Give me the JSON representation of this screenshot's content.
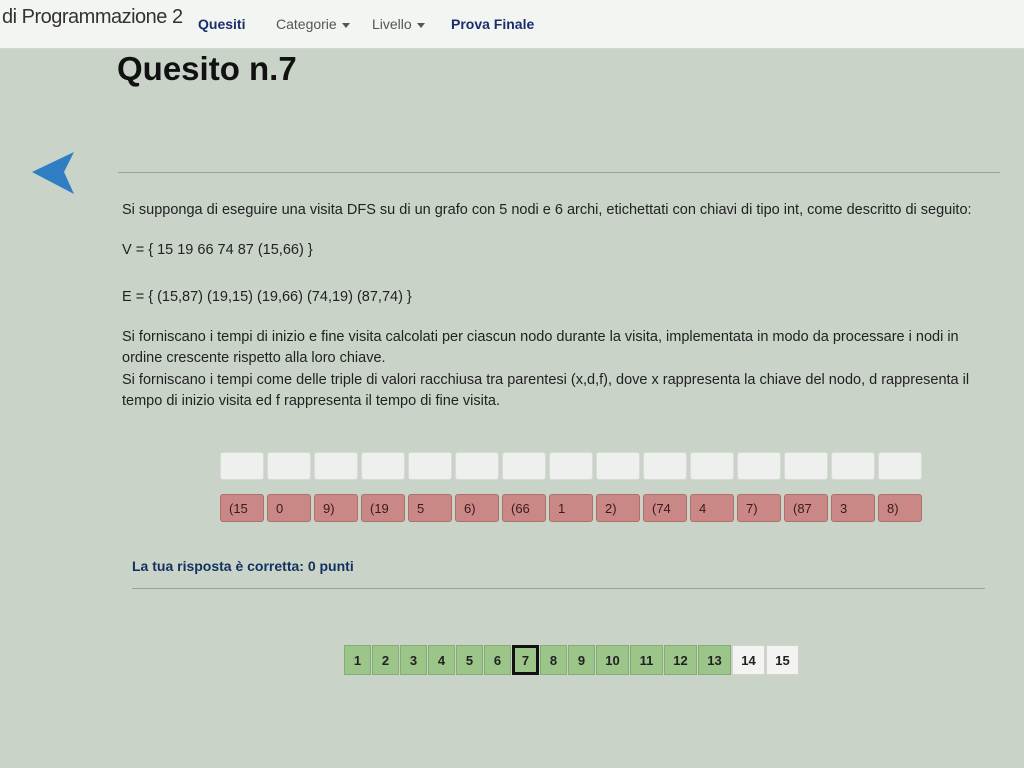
{
  "navbar": {
    "brand": "di Programmazione 2",
    "quesiti": "Quesiti",
    "categorie": "Categorie",
    "livello": "Livello",
    "prova_finale": "Prova Finale"
  },
  "question": {
    "title": "Quesito n.7",
    "intro": "Si supponga di eseguire una visita DFS su di un grafo con 5 nodi e 6 archi, etichettati con chiavi di tipo int, come descritto di seguito:",
    "v_set": "V = { 15 19 66 74 87 (15,66) }",
    "e_set": "E = { (15,87) (19,15) (19,66) (74,19) (87,74) }",
    "paragraph1": "Si forniscano i tempi di inizio e fine visita calcolati per ciascun nodo durante la visita, implementata in modo da processare i nodi in ordine crescente rispetto alla loro chiave.",
    "paragraph2": "Si forniscano i tempi come delle triple di valori racchiusa tra parentesi (x,d,f), dove x rappresenta la chiave del nodo, d rappresenta il tempo di inizio visita ed f rappresenta il tempo di fine visita."
  },
  "answer_inputs": [
    "",
    "",
    "",
    "",
    "",
    "",
    "",
    "",
    "",
    "",
    "",
    "",
    "",
    "",
    ""
  ],
  "correct_answers": [
    "(15",
    "0",
    "9)",
    "(19",
    "5",
    "6)",
    "(66",
    "1",
    "2)",
    "(74",
    "4",
    "7)",
    "(87",
    "3",
    "8)"
  ],
  "result_text": "La tua risposta è corretta: 0 punti",
  "pagination": {
    "pages": [
      "1",
      "2",
      "3",
      "4",
      "5",
      "6",
      "7",
      "8",
      "9",
      "10",
      "11",
      "12",
      "13",
      "14",
      "15"
    ],
    "current": "7",
    "answered_up_to": 13
  },
  "colors": {
    "answered_page": "#9cc58a",
    "correct_cell": "#c98785",
    "nav_accent": "#1a2f6a",
    "back_arrow": "#2f7ec4"
  }
}
